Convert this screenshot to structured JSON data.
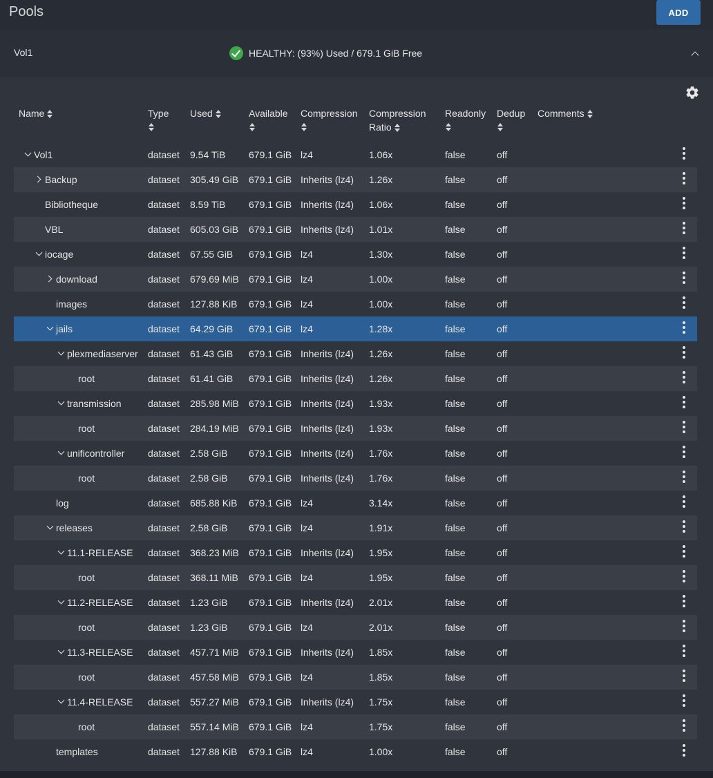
{
  "header": {
    "title": "Pools",
    "add_label": "ADD"
  },
  "pool": {
    "name": "Vol1",
    "status": "HEALTHY: (93%) Used / 679.1 GiB Free",
    "status_color": "#3fa64a"
  },
  "columns": {
    "name": "Name",
    "type": "Type",
    "used": "Used",
    "available": "Available",
    "compression": "Compression",
    "ratio_line1": "Compression",
    "ratio_line2": "Ratio",
    "readonly": "Readonly",
    "dedup": "Dedup",
    "comments": "Comments"
  },
  "rows": [
    {
      "name": "Vol1",
      "depth": 0,
      "expander": "down",
      "type": "dataset",
      "used": "9.54 TiB",
      "available": "679.1 GiB",
      "compression": "lz4",
      "ratio": "1.06x",
      "readonly": "false",
      "dedup": "off"
    },
    {
      "name": "Backup",
      "depth": 1,
      "expander": "right",
      "type": "dataset",
      "used": "305.49 GiB",
      "available": "679.1 GiB",
      "compression": "Inherits (lz4)",
      "ratio": "1.26x",
      "readonly": "false",
      "dedup": "off"
    },
    {
      "name": "Bibliotheque",
      "depth": 1,
      "expander": "none",
      "type": "dataset",
      "used": "8.59 TiB",
      "available": "679.1 GiB",
      "compression": "Inherits (lz4)",
      "ratio": "1.06x",
      "readonly": "false",
      "dedup": "off"
    },
    {
      "name": "VBL",
      "depth": 1,
      "expander": "none",
      "type": "dataset",
      "used": "605.03 GiB",
      "available": "679.1 GiB",
      "compression": "Inherits (lz4)",
      "ratio": "1.01x",
      "readonly": "false",
      "dedup": "off"
    },
    {
      "name": "iocage",
      "depth": 1,
      "expander": "down",
      "type": "dataset",
      "used": "67.55 GiB",
      "available": "679.1 GiB",
      "compression": "lz4",
      "ratio": "1.30x",
      "readonly": "false",
      "dedup": "off"
    },
    {
      "name": "download",
      "depth": 2,
      "expander": "right",
      "type": "dataset",
      "used": "679.69 MiB",
      "available": "679.1 GiB",
      "compression": "lz4",
      "ratio": "1.00x",
      "readonly": "false",
      "dedup": "off"
    },
    {
      "name": "images",
      "depth": 2,
      "expander": "none",
      "type": "dataset",
      "used": "127.88 KiB",
      "available": "679.1 GiB",
      "compression": "lz4",
      "ratio": "1.00x",
      "readonly": "false",
      "dedup": "off"
    },
    {
      "name": "jails",
      "depth": 2,
      "expander": "down",
      "selected": true,
      "type": "dataset",
      "used": "64.29 GiB",
      "available": "679.1 GiB",
      "compression": "lz4",
      "ratio": "1.28x",
      "readonly": "false",
      "dedup": "off"
    },
    {
      "name": "plexmediaserver",
      "depth": 3,
      "expander": "down",
      "type": "dataset",
      "used": "61.43 GiB",
      "available": "679.1 GiB",
      "compression": "Inherits (lz4)",
      "ratio": "1.26x",
      "readonly": "false",
      "dedup": "off"
    },
    {
      "name": "root",
      "depth": 4,
      "expander": "none",
      "type": "dataset",
      "used": "61.41 GiB",
      "available": "679.1 GiB",
      "compression": "Inherits (lz4)",
      "ratio": "1.26x",
      "readonly": "false",
      "dedup": "off"
    },
    {
      "name": "transmission",
      "depth": 3,
      "expander": "down",
      "type": "dataset",
      "used": "285.98 MiB",
      "available": "679.1 GiB",
      "compression": "Inherits (lz4)",
      "ratio": "1.93x",
      "readonly": "false",
      "dedup": "off"
    },
    {
      "name": "root",
      "depth": 4,
      "expander": "none",
      "type": "dataset",
      "used": "284.19 MiB",
      "available": "679.1 GiB",
      "compression": "Inherits (lz4)",
      "ratio": "1.93x",
      "readonly": "false",
      "dedup": "off"
    },
    {
      "name": "unificontroller",
      "depth": 3,
      "expander": "down",
      "type": "dataset",
      "used": "2.58 GiB",
      "available": "679.1 GiB",
      "compression": "Inherits (lz4)",
      "ratio": "1.76x",
      "readonly": "false",
      "dedup": "off"
    },
    {
      "name": "root",
      "depth": 4,
      "expander": "none",
      "type": "dataset",
      "used": "2.58 GiB",
      "available": "679.1 GiB",
      "compression": "Inherits (lz4)",
      "ratio": "1.76x",
      "readonly": "false",
      "dedup": "off"
    },
    {
      "name": "log",
      "depth": 2,
      "expander": "none",
      "type": "dataset",
      "used": "685.88 KiB",
      "available": "679.1 GiB",
      "compression": "lz4",
      "ratio": "3.14x",
      "readonly": "false",
      "dedup": "off"
    },
    {
      "name": "releases",
      "depth": 2,
      "expander": "down",
      "type": "dataset",
      "used": "2.58 GiB",
      "available": "679.1 GiB",
      "compression": "lz4",
      "ratio": "1.91x",
      "readonly": "false",
      "dedup": "off"
    },
    {
      "name": "11.1-RELEASE",
      "depth": 3,
      "expander": "down",
      "type": "dataset",
      "used": "368.23 MiB",
      "available": "679.1 GiB",
      "compression": "Inherits (lz4)",
      "ratio": "1.95x",
      "readonly": "false",
      "dedup": "off"
    },
    {
      "name": "root",
      "depth": 4,
      "expander": "none",
      "type": "dataset",
      "used": "368.11 MiB",
      "available": "679.1 GiB",
      "compression": "lz4",
      "ratio": "1.95x",
      "readonly": "false",
      "dedup": "off"
    },
    {
      "name": "11.2-RELEASE",
      "depth": 3,
      "expander": "down",
      "type": "dataset",
      "used": "1.23 GiB",
      "available": "679.1 GiB",
      "compression": "Inherits (lz4)",
      "ratio": "2.01x",
      "readonly": "false",
      "dedup": "off"
    },
    {
      "name": "root",
      "depth": 4,
      "expander": "none",
      "type": "dataset",
      "used": "1.23 GiB",
      "available": "679.1 GiB",
      "compression": "lz4",
      "ratio": "2.01x",
      "readonly": "false",
      "dedup": "off"
    },
    {
      "name": "11.3-RELEASE",
      "depth": 3,
      "expander": "down",
      "type": "dataset",
      "used": "457.71 MiB",
      "available": "679.1 GiB",
      "compression": "Inherits (lz4)",
      "ratio": "1.85x",
      "readonly": "false",
      "dedup": "off"
    },
    {
      "name": "root",
      "depth": 4,
      "expander": "none",
      "type": "dataset",
      "used": "457.58 MiB",
      "available": "679.1 GiB",
      "compression": "lz4",
      "ratio": "1.85x",
      "readonly": "false",
      "dedup": "off"
    },
    {
      "name": "11.4-RELEASE",
      "depth": 3,
      "expander": "down",
      "type": "dataset",
      "used": "557.27 MiB",
      "available": "679.1 GiB",
      "compression": "Inherits (lz4)",
      "ratio": "1.75x",
      "readonly": "false",
      "dedup": "off"
    },
    {
      "name": "root",
      "depth": 4,
      "expander": "none",
      "type": "dataset",
      "used": "557.14 MiB",
      "available": "679.1 GiB",
      "compression": "lz4",
      "ratio": "1.75x",
      "readonly": "false",
      "dedup": "off"
    },
    {
      "name": "templates",
      "depth": 2,
      "expander": "none",
      "type": "dataset",
      "used": "127.88 KiB",
      "available": "679.1 GiB",
      "compression": "lz4",
      "ratio": "1.00x",
      "readonly": "false",
      "dedup": "off"
    }
  ],
  "icons": {
    "status": "check-circle-icon",
    "collapse": "chevron-up-icon",
    "settings": "gear-icon",
    "row_menu": "kebab-menu-icon",
    "sort": "sort-icon"
  }
}
